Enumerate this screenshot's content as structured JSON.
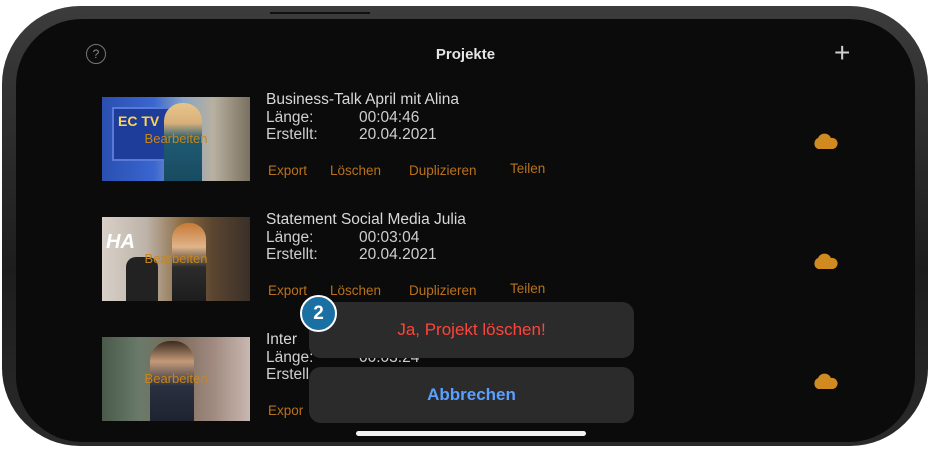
{
  "header": {
    "title": "Projekte",
    "help_glyph": "?",
    "add_glyph": "+"
  },
  "projects": [
    {
      "title": "Business-Talk April mit Alina",
      "length_label": "Länge:",
      "length": "00:04:46",
      "created_label": "Erstellt:",
      "created": "20.04.2021",
      "thumb_overlay": "Bearbeiten",
      "thumb_logo": "EC TV"
    },
    {
      "title": "Statement Social Media Julia",
      "length_label": "Länge:",
      "length": "00:03:04",
      "created_label": "Erstellt:",
      "created": "20.04.2021",
      "thumb_overlay": "Bearbeiten"
    },
    {
      "title": "Inter",
      "length_label": "Länge:",
      "length": "00:03:24",
      "created_label": "Erstell",
      "created": "",
      "thumb_overlay": "Bearbeiten"
    }
  ],
  "actions": {
    "export": "Export",
    "delete": "Löschen",
    "duplicate": "Duplizieren",
    "share": "Teilen",
    "export_partial": "Expor"
  },
  "dialog": {
    "confirm": "Ja, Projekt löschen!",
    "cancel": "Abbrechen"
  },
  "badge": "2",
  "colors": {
    "accent": "#c8861c",
    "destructive": "#ff453a",
    "cancel": "#5aa0ff",
    "badge": "#1a6fa3"
  }
}
